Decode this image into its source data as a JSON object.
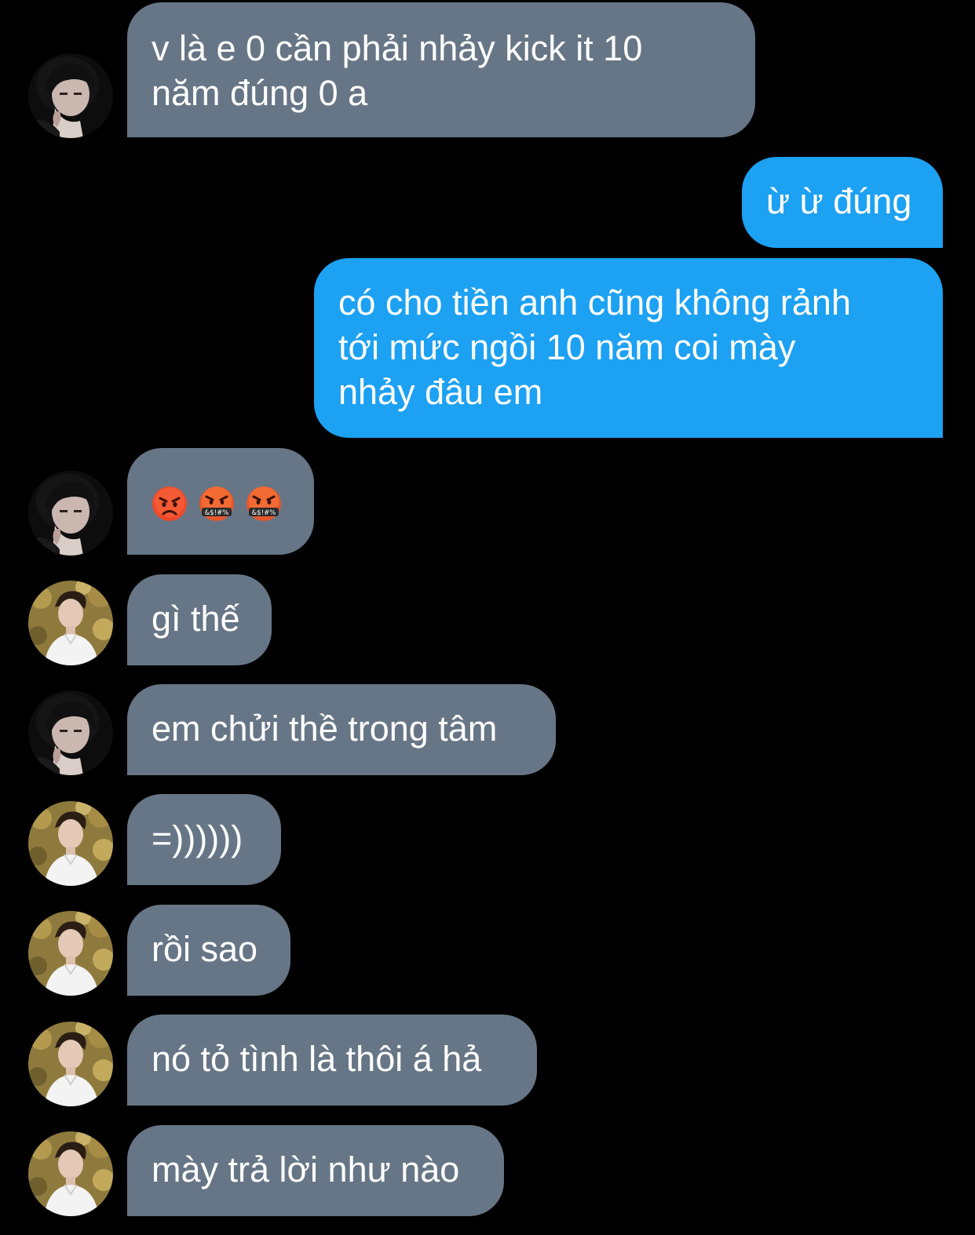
{
  "colors": {
    "background": "#000000",
    "incoming_bubble": "#677686",
    "outgoing_bubble": "#1da1f2",
    "text": "#ffffff"
  },
  "messages": [
    {
      "id": "m1",
      "side": "incoming",
      "sender": "girl",
      "text": "v là e 0 cần phải nhảy kick it 10\nnăm đúng 0 a"
    },
    {
      "id": "m2",
      "side": "outgoing",
      "text": "ừ ừ đúng"
    },
    {
      "id": "m3",
      "side": "outgoing",
      "text": "có cho tiền anh cũng không rảnh\ntới mức ngồi 10 năm coi mày\nnhảy đâu em"
    },
    {
      "id": "m4",
      "side": "incoming",
      "sender": "girl",
      "emojis": [
        "pouting-face-emoji",
        "face-with-symbols-on-mouth-emoji",
        "face-with-symbols-on-mouth-emoji"
      ],
      "emoji_symbol_text": "&$!#%"
    },
    {
      "id": "m5",
      "side": "incoming",
      "sender": "boy",
      "text": "gì thế"
    },
    {
      "id": "m6",
      "side": "incoming",
      "sender": "girl",
      "text": "em chửi thề trong tâm"
    },
    {
      "id": "m7",
      "side": "incoming",
      "sender": "boy",
      "text": "=))))))"
    },
    {
      "id": "m8",
      "side": "incoming",
      "sender": "boy",
      "text": "rồi sao"
    },
    {
      "id": "m9",
      "side": "incoming",
      "sender": "boy",
      "text": "nó tỏ tình là thôi á hả"
    },
    {
      "id": "m10",
      "side": "incoming",
      "sender": "boy",
      "text": "mày trả lời như nào"
    }
  ]
}
